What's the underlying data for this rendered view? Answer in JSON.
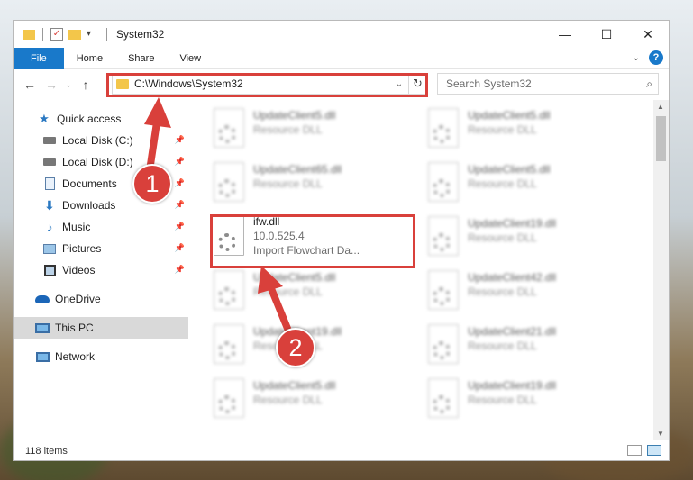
{
  "window": {
    "title": "System32"
  },
  "ribbon": {
    "tabs": [
      "File",
      "Home",
      "Share",
      "View"
    ],
    "help_label": "?"
  },
  "address": {
    "path": "C:\\Windows\\System32",
    "search_placeholder": "Search System32"
  },
  "sidebar": {
    "items": [
      {
        "label": "Quick access",
        "icon": "star-icon"
      },
      {
        "label": "Local Disk (C:)",
        "icon": "drive-icon",
        "pinned": true
      },
      {
        "label": "Local Disk (D:)",
        "icon": "drive-icon",
        "pinned": true
      },
      {
        "label": "Documents",
        "icon": "documents-icon",
        "pinned": true
      },
      {
        "label": "Downloads",
        "icon": "download-icon",
        "pinned": true
      },
      {
        "label": "Music",
        "icon": "music-icon",
        "pinned": true
      },
      {
        "label": "Pictures",
        "icon": "pictures-icon",
        "pinned": true
      },
      {
        "label": "Videos",
        "icon": "videos-icon",
        "pinned": true
      },
      {
        "label": "OneDrive",
        "icon": "cloud-icon"
      },
      {
        "label": "This PC",
        "icon": "computer-icon",
        "selected": true
      },
      {
        "label": "Network",
        "icon": "network-icon"
      }
    ]
  },
  "files": [
    {
      "name": "UpdateClient5.dll",
      "sub": "Resource DLL",
      "blurred": true
    },
    {
      "name": "UpdateClient5.dll",
      "sub": "Resource DLL",
      "blurred": true
    },
    {
      "name": "UpdateClient65.dll",
      "sub": "Resource DLL",
      "blurred": true
    },
    {
      "name": "UpdateClient5.dll",
      "sub": "Resource DLL",
      "blurred": true
    },
    {
      "name": "ifw.dll",
      "version": "10.0.525.4",
      "sub": "Import Flowchart Da...",
      "blurred": false
    },
    {
      "name": "UpdateClient19.dll",
      "sub": "Resource DLL",
      "blurred": true
    },
    {
      "name": "UpdateClient5.dll",
      "sub": "Resource DLL",
      "blurred": true
    },
    {
      "name": "UpdateClient42.dll",
      "sub": "Resource DLL",
      "blurred": true
    },
    {
      "name": "UpdateClient19.dll",
      "sub": "Resource DLL",
      "blurred": true
    },
    {
      "name": "UpdateClient21.dll",
      "sub": "Resource DLL",
      "blurred": true
    },
    {
      "name": "UpdateClient5.dll",
      "sub": "Resource DLL",
      "blurred": true
    },
    {
      "name": "UpdateClient19.dll",
      "sub": "Resource DLL",
      "blurred": true
    }
  ],
  "status": {
    "item_count": "118 items"
  },
  "annotations": {
    "step1": "1",
    "step2": "2",
    "color": "#d9403b"
  }
}
